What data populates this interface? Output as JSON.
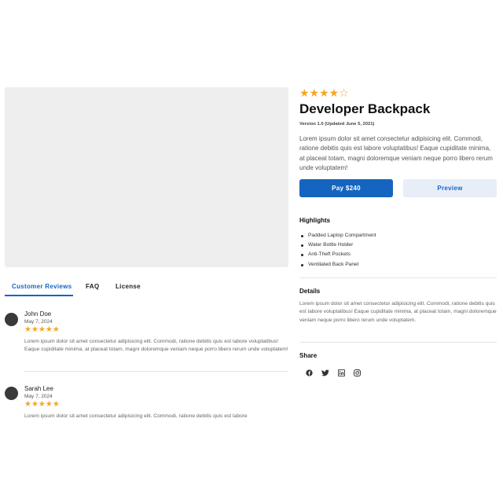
{
  "product": {
    "title": "Developer Backpack",
    "rating_stars": "★★★★☆",
    "version": "Version 1.0 (Updated June 5, 2021)",
    "description": "Lorem ipsum dolor sit amet consectetur adipisicing elit. Commodi, ratione debitis quis est labore voluptatibus! Eaque cupiditate minima, at placeat totam, magni doloremque veniam neque porro libero rerum unde voluptatem!",
    "pay_label": "Pay $240",
    "preview_label": "Preview"
  },
  "highlights": {
    "title": "Highlights",
    "items": [
      "Padded Laptop Compartment",
      "Water Bottle Holder",
      "Anti-Theft Pockets",
      "Ventilated Back Panel"
    ]
  },
  "details": {
    "title": "Details",
    "text": "Lorem ipsum dolor sit amet consectetur adipisicing elit. Commodi, ratione debitis quis est labore voluptatibus! Eaque cupiditate minima, at placeat totam, magni doloremque veniam neque porro libero rerum unde voluptatem."
  },
  "share": {
    "title": "Share",
    "icons": [
      "facebook-icon",
      "twitter-icon",
      "linkedin-icon",
      "instagram-icon"
    ]
  },
  "tabs": [
    {
      "label": "Customer Reviews",
      "active": true
    },
    {
      "label": "FAQ",
      "active": false
    },
    {
      "label": "License",
      "active": false
    }
  ],
  "reviews": [
    {
      "name": "John Doe",
      "date": "May 7, 2024",
      "stars": "★★★★★",
      "text": "Lorem ipsum dolor sit amet consectetur adipisicing elit. Commodi, ratione debitis quis est labore voluptatibus! Eaque cupiditate minima, at placeat totam, magni doloremque veniam neque porro libero rerum unde voluptatem!"
    },
    {
      "name": "Sarah Lee",
      "date": "May 7, 2024",
      "stars": "★★★★★",
      "text": "Lorem ipsum dolor sit amet consectetur adipisicing elit. Commodi, ratione debitis quis est labore"
    }
  ],
  "colors": {
    "accent": "#1565c0",
    "star": "#f5a623",
    "placeholder": "#eeeeee"
  }
}
